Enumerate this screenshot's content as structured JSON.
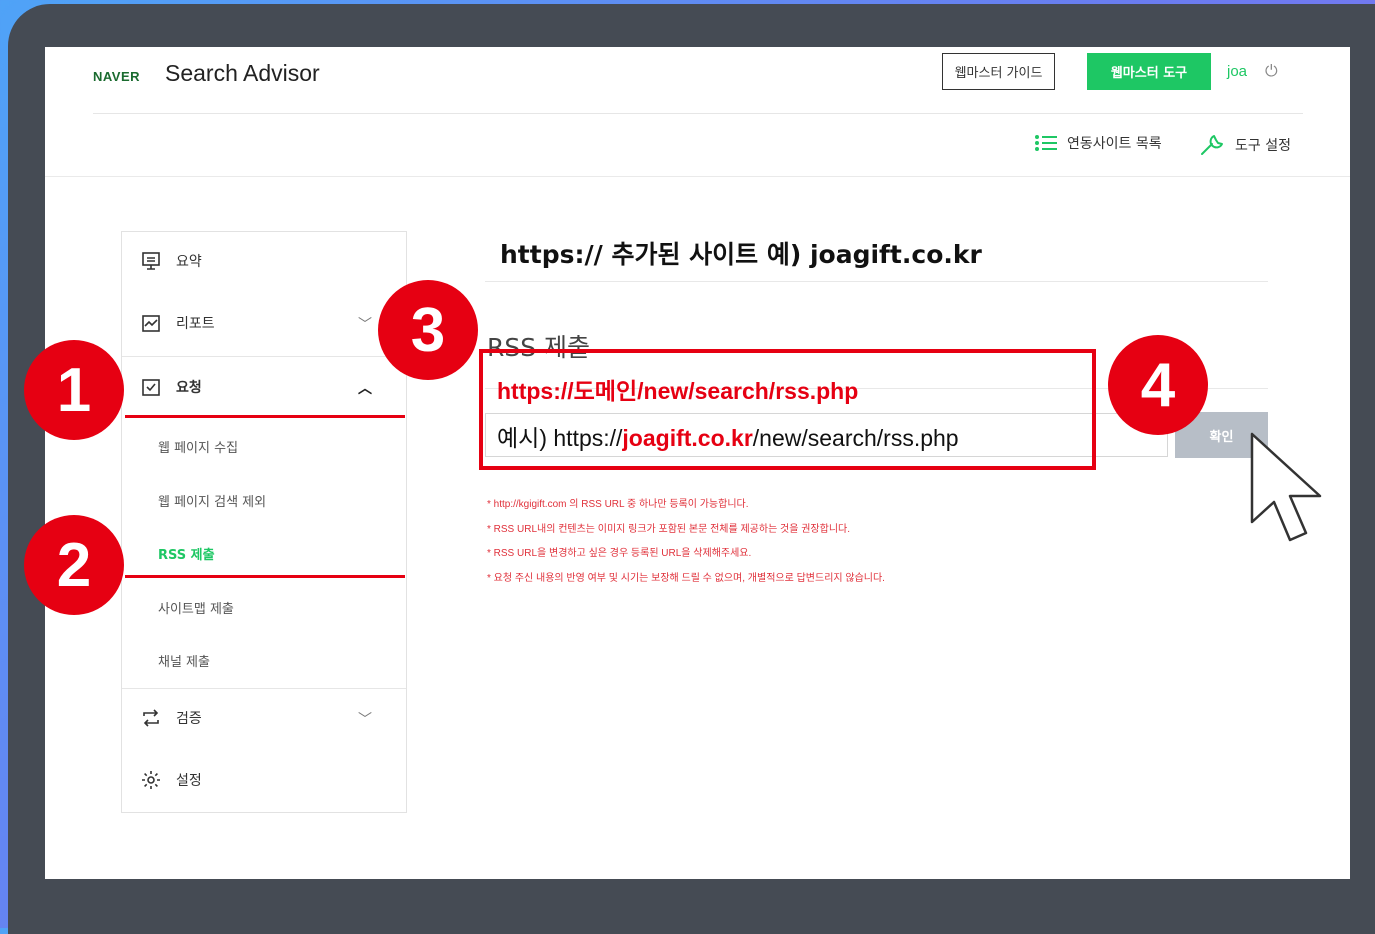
{
  "header": {
    "logo": "NAVER",
    "brand": "Search Advisor",
    "guide_button": "웹마스터 가이드",
    "tool_button": "웹마스터 도구",
    "user": "joa",
    "site_list_link": "연동사이트 목록",
    "tool_settings_link": "도구 설정"
  },
  "sidebar": {
    "summary": "요약",
    "report": "리포트",
    "request": "요청",
    "request_items": [
      "웹 페이지 수집",
      "웹 페이지 검색 제외",
      "RSS 제출",
      "사이트맵 제출",
      "채널 제출"
    ],
    "verify": "검증",
    "settings": "설정"
  },
  "main": {
    "site_title": "https:// 추가된 사이트 예) joagift.co.kr",
    "section_title": "RSS 제출",
    "url_format": "https://도메인/new/search/rss.php",
    "example_prefix": "예시) ",
    "example_scheme": "https://",
    "example_domain": "joagift.co.kr",
    "example_path": "/new/search/rss.php",
    "confirm_button": "확인",
    "notes": [
      "* http://kgigift.com 의 RSS URL 중 하나만 등록이 가능합니다.",
      "* RSS URL내의 컨텐츠는 이미지 링크가 포함된 본문 전체를 제공하는 것을 권장합니다.",
      "* RSS URL을 변경하고 싶은 경우 등록된 URL을 삭제해주세요.",
      "* 요청 주신 내용의 반영 여부 및 시기는 보장해 드릴 수 없으며, 개별적으로 답변드리지 않습니다."
    ]
  },
  "badges": [
    "1",
    "2",
    "3",
    "4"
  ],
  "colors": {
    "accent_green": "#1ec764",
    "marker_red": "#e60012",
    "bezel": "#454b54"
  }
}
